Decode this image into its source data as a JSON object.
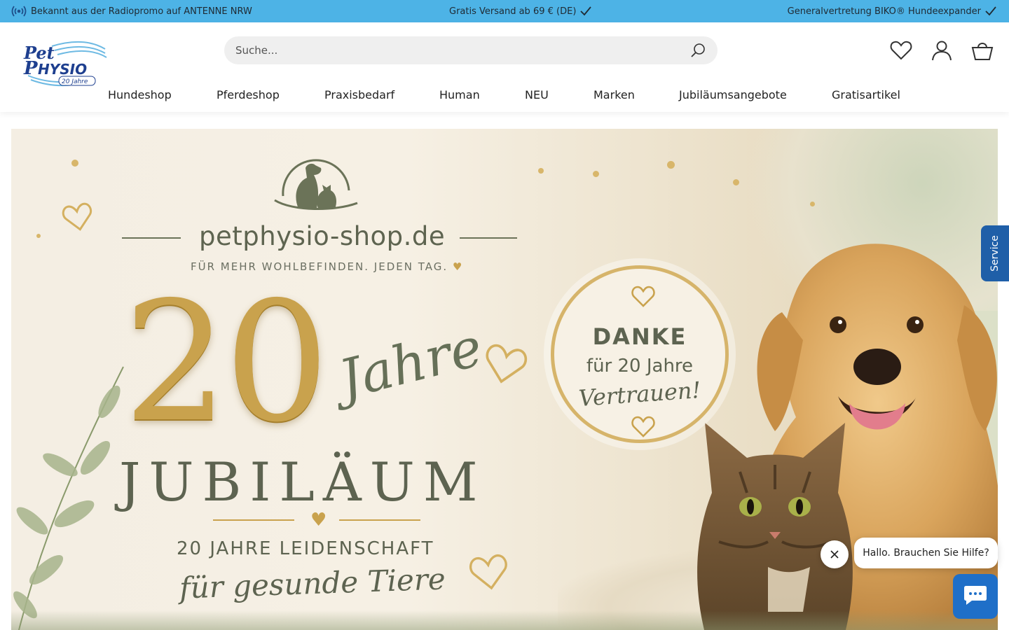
{
  "topbar": {
    "left_text": "Bekannt aus der Radiopromo auf ANTENNE NRW",
    "center_text": "Gratis Versand ab 69 € (DE)",
    "right_text": "Generalvertretung BIKO® Hundeexpander",
    "left_icon": "radio-broadcast-icon",
    "check_icon": "checkmark-icon",
    "background": "#4db3e6"
  },
  "logo": {
    "line1": "Pet",
    "line2": "HYSIO",
    "badge": "20 Jahre"
  },
  "search": {
    "placeholder": "Suche...",
    "icon": "search-icon"
  },
  "header_icons": [
    "wishlist-heart-icon",
    "account-user-icon",
    "cart-basket-icon"
  ],
  "nav": {
    "items": [
      {
        "label": "Hundeshop"
      },
      {
        "label": "Pferdeshop"
      },
      {
        "label": "Praxisbedarf"
      },
      {
        "label": "Human"
      },
      {
        "label": "NEU"
      },
      {
        "label": "Marken"
      },
      {
        "label": "Jubiläumsangebote"
      },
      {
        "label": "Gratisartikel"
      }
    ]
  },
  "hero": {
    "brand": "petphysio-shop.de",
    "tagline": "FÜR MEHR WOHLBEFINDEN. JEDEN TAG.",
    "number": "20",
    "jahre": "Jahre",
    "jubilaeum": "JUBILÄUM",
    "leidenschaft": "20 JAHRE LEIDENSCHAFT",
    "gesunde": "für gesunde Tiere",
    "badge": {
      "line1": "DANKE",
      "line2": "für 20 Jahre",
      "line3": "Vertrauen!"
    },
    "colors": {
      "gold": "#c9a24d",
      "olive": "#5d6350"
    }
  },
  "service_tab": {
    "label": "Service"
  },
  "chat": {
    "message": "Hallo. Brauchen Sie Hilfe?",
    "close_icon": "close-icon",
    "chat_icon": "chat-icon",
    "color": "#1f6fc8"
  }
}
